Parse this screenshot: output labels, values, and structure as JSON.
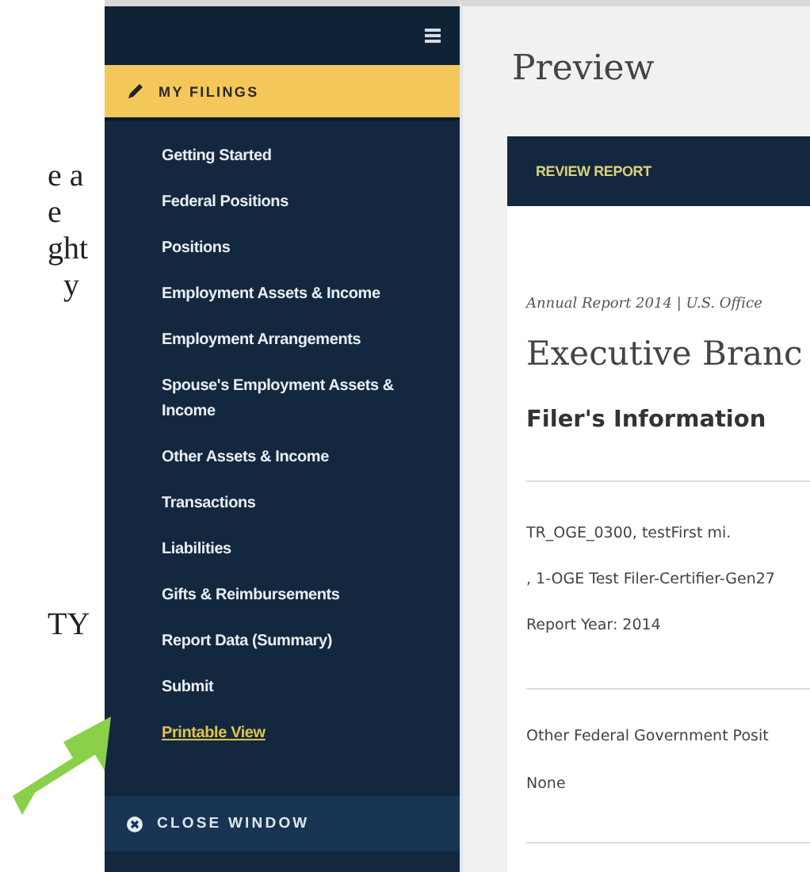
{
  "document_fragments": [
    "e a",
    "e",
    "ght",
    "y",
    "TY"
  ],
  "sidebar": {
    "section": {
      "label": "MY FILINGS",
      "selected": true
    },
    "items": [
      {
        "label": "Getting Started",
        "kind": "item"
      },
      {
        "label": "Federal Positions",
        "kind": "item"
      },
      {
        "label": "Positions",
        "kind": "item"
      },
      {
        "label": "Employment Assets & Income",
        "kind": "item"
      },
      {
        "label": "Employment Arrangements",
        "kind": "item"
      },
      {
        "label": "Spouse's Employment Assets & Income",
        "kind": "item"
      },
      {
        "label": "Other Assets & Income",
        "kind": "item"
      },
      {
        "label": "Transactions",
        "kind": "item"
      },
      {
        "label": "Liabilities",
        "kind": "item"
      },
      {
        "label": "Gifts & Reimbursements",
        "kind": "item"
      },
      {
        "label": "Report Data (Summary)",
        "kind": "item"
      },
      {
        "label": "Submit",
        "kind": "item"
      },
      {
        "label": "Printable View",
        "kind": "link"
      }
    ],
    "close_button": "CLOSE WINDOW"
  },
  "main": {
    "title": "Preview",
    "card": {
      "header": "REVIEW REPORT",
      "subtitle": "Annual Report 2014 | U.S. Office",
      "heading": "Executive Branc",
      "section_title": "Filer's Information",
      "filer_lines": [
        "TR_OGE_0300, testFirst mi.",
        ", 1-OGE Test Filer-Certifier-Gen27",
        "Report Year: 2014"
      ],
      "fields": [
        {
          "label": "Other Federal Government Posit",
          "value": "None"
        }
      ]
    }
  }
}
